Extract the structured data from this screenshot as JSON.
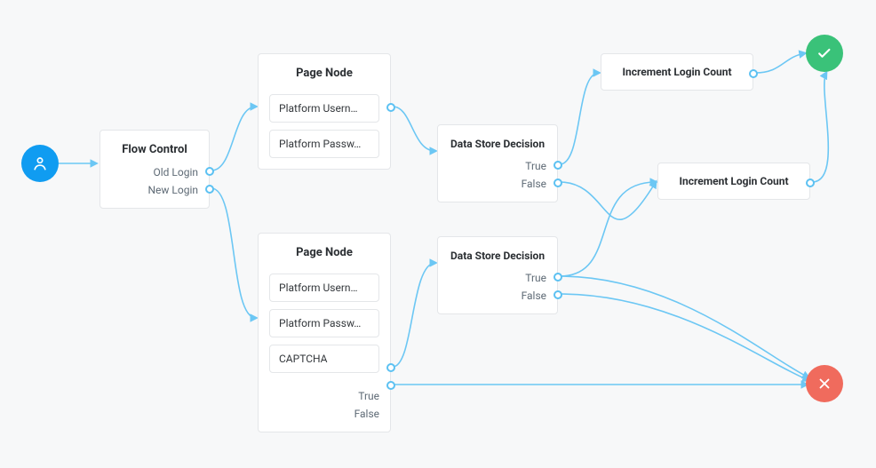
{
  "nodes": {
    "flowControl": {
      "title": "Flow Control",
      "options": [
        "Old Login",
        "New Login"
      ]
    },
    "pageNode1": {
      "title": "Page Node",
      "fields": [
        "Platform Usern…",
        "Platform Passw…"
      ]
    },
    "pageNode2": {
      "title": "Page Node",
      "fields": [
        "Platform Usern…",
        "Platform Passw…",
        "CAPTCHA"
      ],
      "options": [
        "True",
        "False"
      ]
    },
    "decision1": {
      "title": "Data Store Decision",
      "options": [
        "True",
        "False"
      ]
    },
    "decision2": {
      "title": "Data Store Decision",
      "options": [
        "True",
        "False"
      ]
    },
    "increment1": {
      "title": "Increment Login Count"
    },
    "increment2": {
      "title": "Increment Login Count"
    }
  },
  "colors": {
    "wire": "#6cc7f4",
    "arrowhead": "#6cc7f4",
    "start": "#109cf1",
    "success": "#3ac279",
    "fail": "#f06b5d"
  }
}
